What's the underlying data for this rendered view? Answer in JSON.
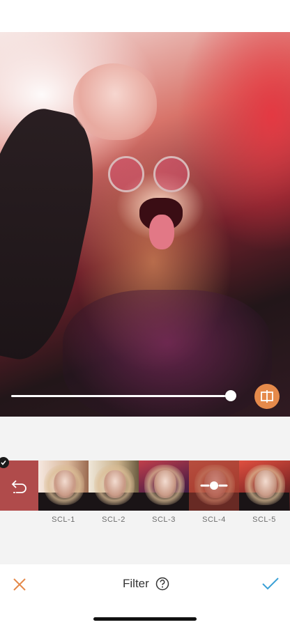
{
  "screen": {
    "title": "Filter"
  },
  "editor": {
    "intensity": 0.99
  },
  "filters": {
    "selected": "original",
    "items": [
      {
        "label": "SCL-1"
      },
      {
        "label": "SCL-2"
      },
      {
        "label": "SCL-3"
      },
      {
        "label": "SCL-4"
      },
      {
        "label": "SCL-5"
      }
    ]
  },
  "icons": {
    "compare": "compare-icon",
    "undo": "undo-arrow-icon",
    "adjust": "slider-adjust-icon",
    "close": "close-icon",
    "help": "help-icon",
    "done": "checkmark-icon",
    "selected": "check-badge-icon"
  },
  "colors": {
    "accent": "#e58a4b",
    "done": "#3aa0d6",
    "panel": "#f3f3f3"
  }
}
